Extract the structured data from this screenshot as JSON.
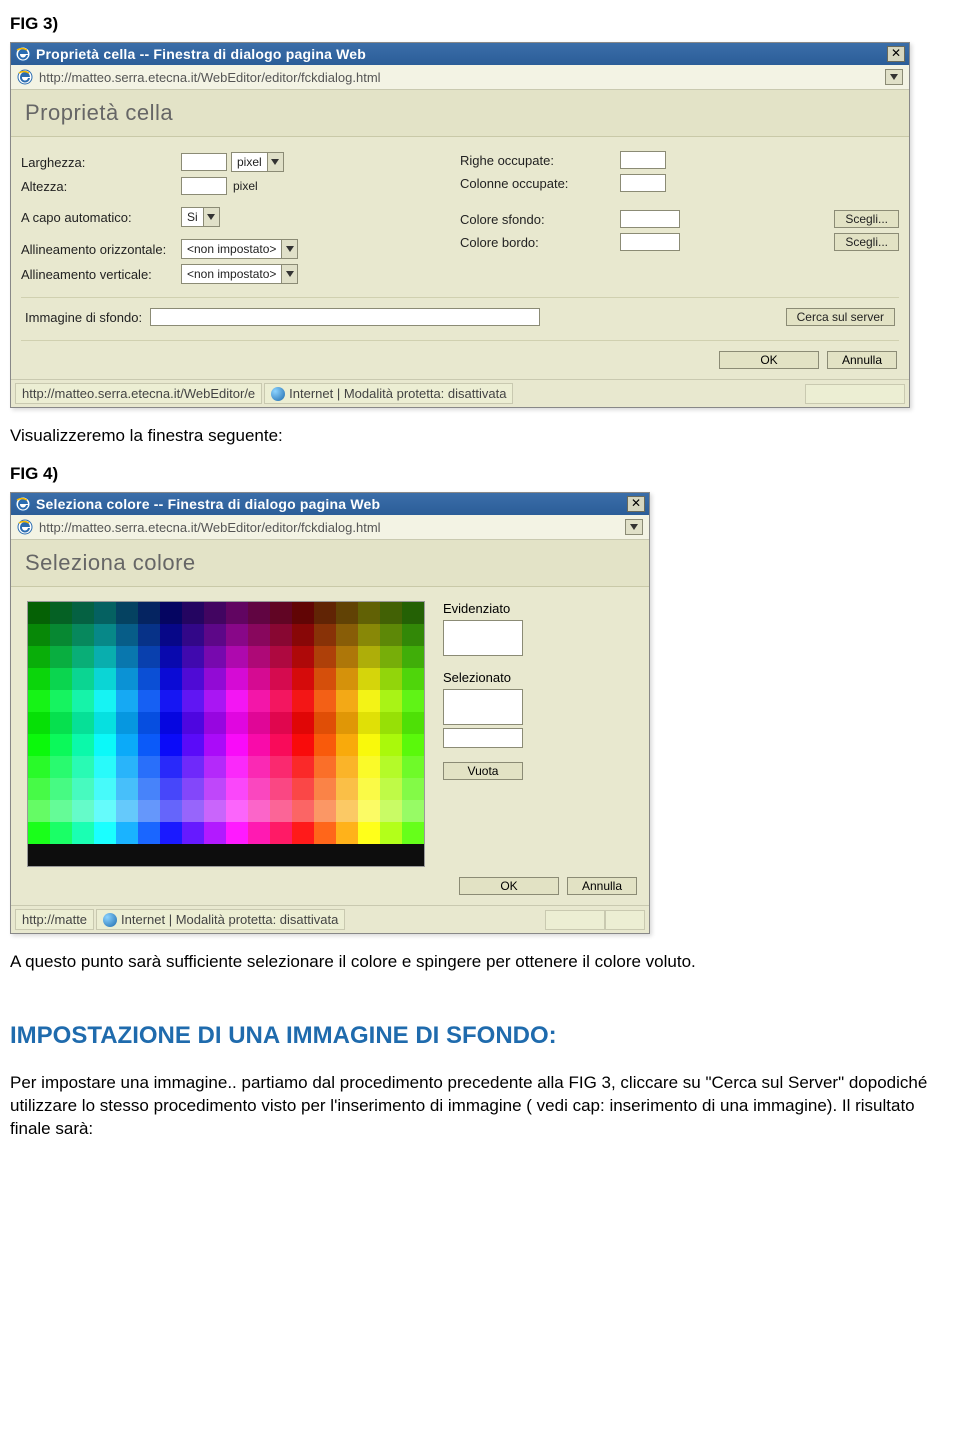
{
  "labels": {
    "fig3": "FIG 3)",
    "fig4": "FIG 4)",
    "caption1": "Visualizzeremo la finestra seguente:",
    "caption2": "A questo punto sarà sufficiente selezionare il colore e spingere per ottenere il colore voluto.",
    "section_title": "IMPOSTAZIONE DI UNA IMMAGINE DI SFONDO:",
    "paragraph": "Per impostare una immagine.. partiamo dal procedimento precedente alla FIG 3, cliccare su \"Cerca sul Server\" dopodiché utilizzare lo stesso procedimento visto per l'inserimento di immagine ( vedi cap: inserimento di una immagine). Il risultato finale sarà:"
  },
  "dialog1": {
    "title": "Proprietà cella -- Finestra di dialogo pagina Web",
    "url": "http://matteo.serra.etecna.it/WebEditor/editor/fckdialog.html",
    "header": "Proprietà cella",
    "left": {
      "larghezza": "Larghezza:",
      "altezza": "Altezza:",
      "pixel_unit": "pixel",
      "acapo": "A capo automatico:",
      "acapo_val": "Si",
      "halign": "Allineamento orizzontale:",
      "valign": "Allineamento verticale:",
      "nonimp": "<non impostato>"
    },
    "right": {
      "righe": "Righe occupate:",
      "colonne": "Colonne occupate:",
      "sfondo": "Colore sfondo:",
      "bordo": "Colore bordo:",
      "scegli": "Scegli..."
    },
    "imgsfondo": "Immagine di sfondo:",
    "cerca": "Cerca sul server",
    "ok": "OK",
    "annulla": "Annulla",
    "status_url": "http://matteo.serra.etecna.it/WebEditor/e",
    "status_mode": "Internet | Modalità protetta: disattivata"
  },
  "dialog2": {
    "title": "Seleziona colore -- Finestra di dialogo pagina Web",
    "url": "http://matteo.serra.etecna.it/WebEditor/editor/fckdialog.html",
    "header": "Seleziona colore",
    "evidenziato": "Evidenziato",
    "selezionato": "Selezionato",
    "vuota": "Vuota",
    "ok": "OK",
    "annulla": "Annulla",
    "status_url": "http://matte",
    "status_mode": "Internet | Modalità protetta: disattivata"
  }
}
